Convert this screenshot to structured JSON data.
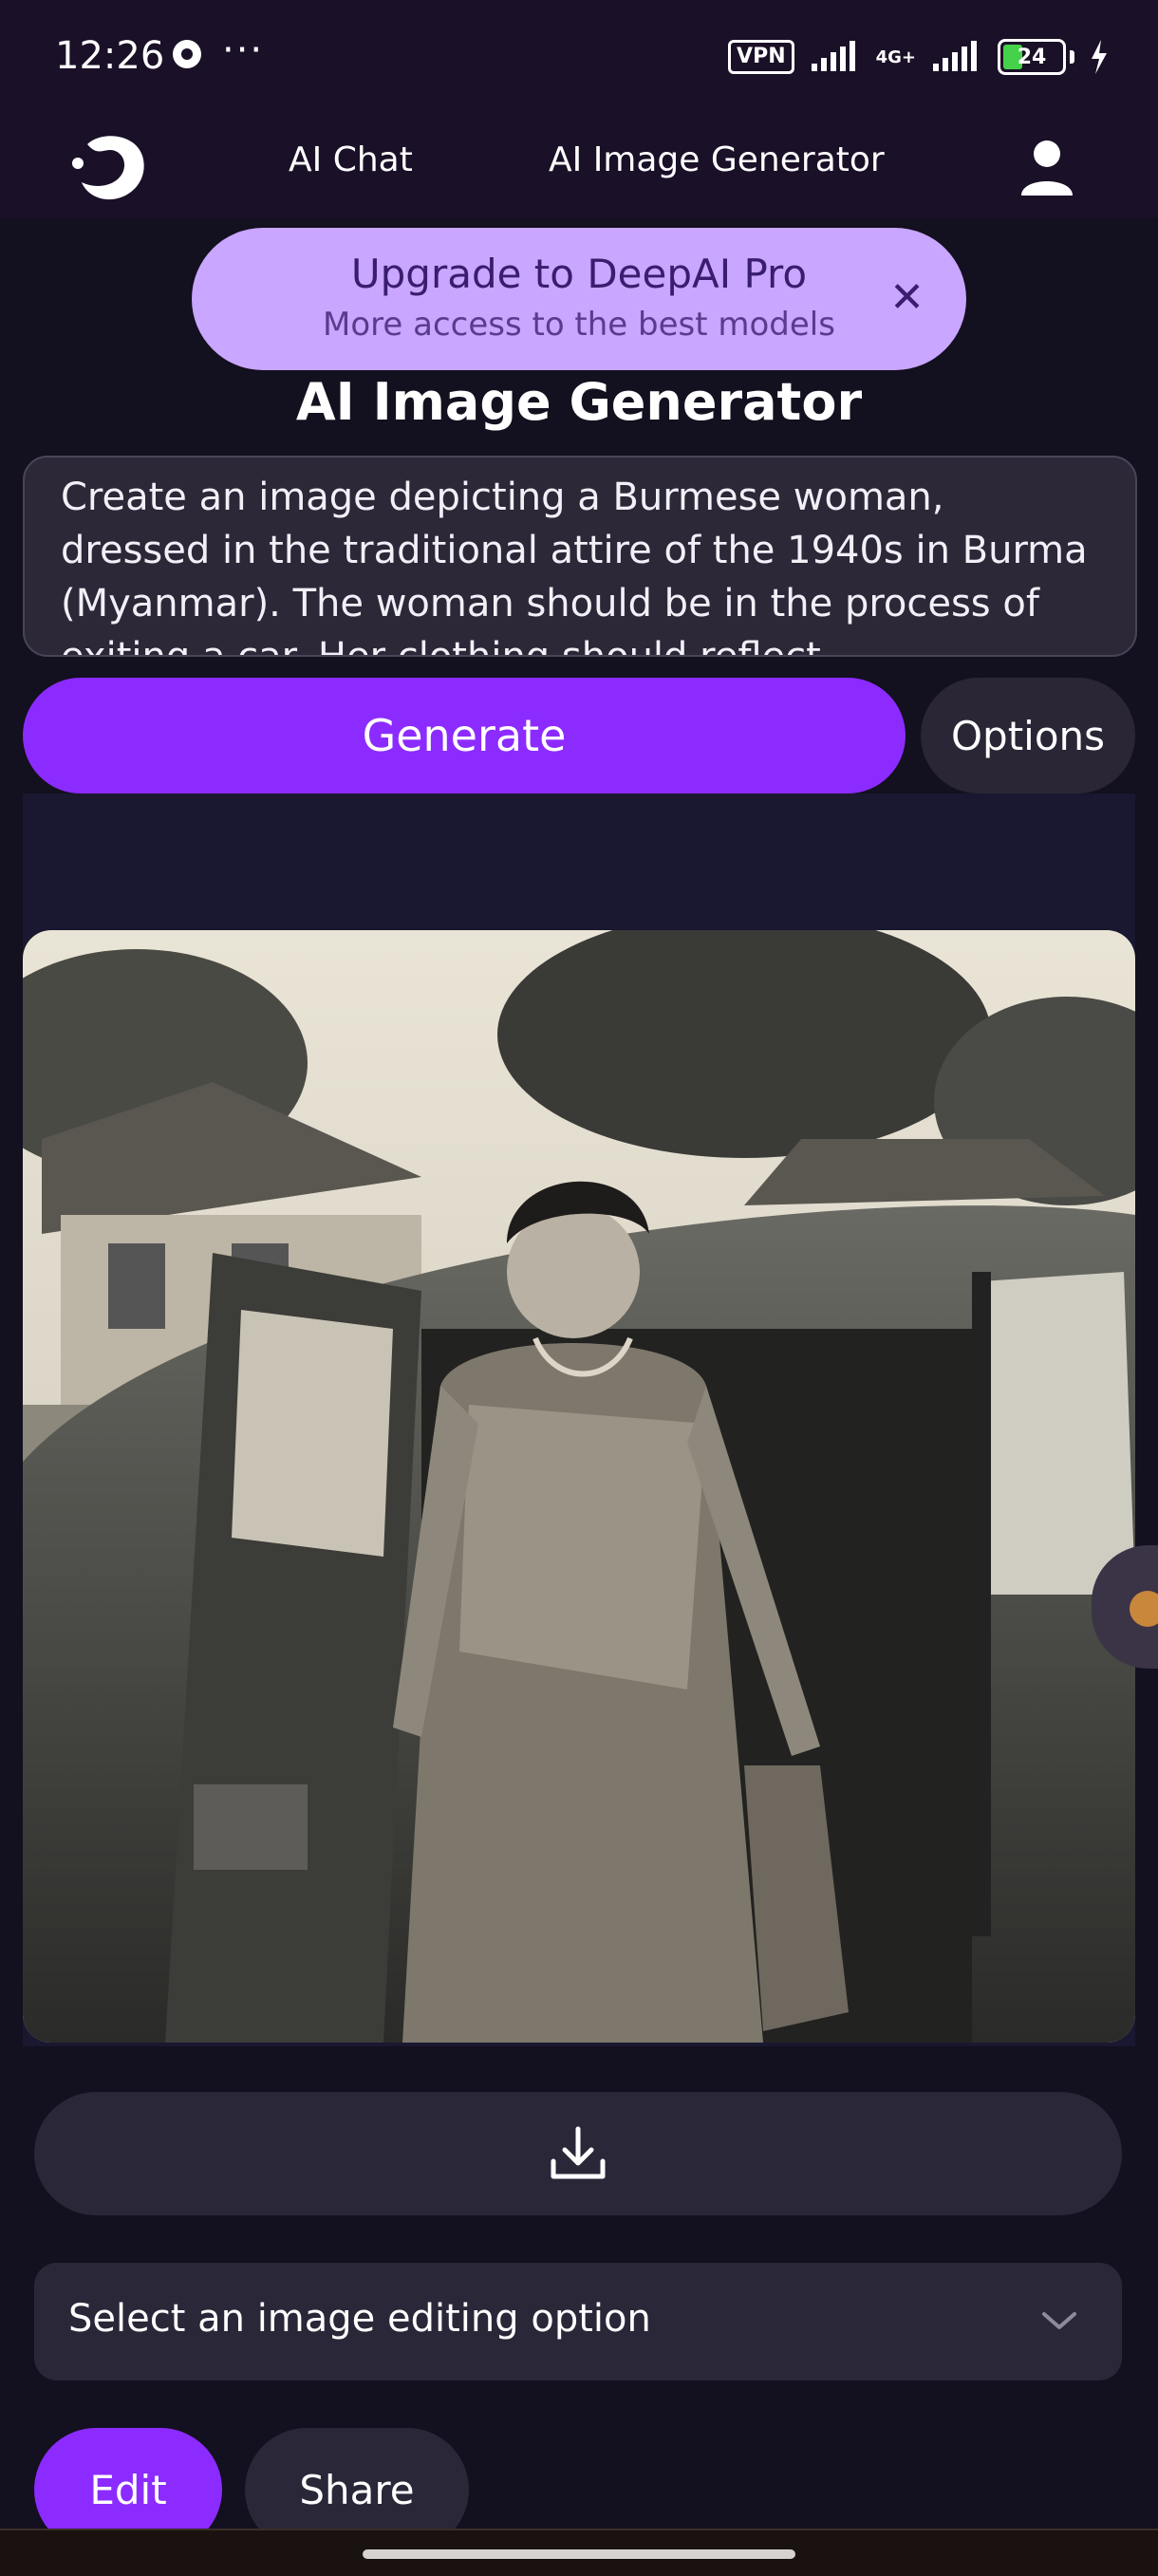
{
  "status_bar": {
    "time": "12:26",
    "more_dots": "···",
    "vpn": "VPN",
    "network": "4G+",
    "battery": "24"
  },
  "header": {
    "nav_chat": "AI Chat",
    "nav_image_generator": "AI Image Generator"
  },
  "promo": {
    "title": "Upgrade to DeepAI Pro",
    "subtitle": "More access to the best models",
    "close": "✕"
  },
  "page": {
    "title": "AI Image Generator"
  },
  "prompt": {
    "text": "Create an image depicting a Burmese woman, dressed in the traditional attire of the 1940s in Burma (Myanmar). The woman should be in the process of exiting a car. Her clothing should reflect"
  },
  "actions": {
    "generate": "Generate",
    "options": "Options"
  },
  "editing": {
    "select_placeholder": "Select an image editing option",
    "edit": "Edit",
    "share": "Share"
  },
  "colors": {
    "accent": "#8c2bff",
    "promo_bg": "#c9a6ff",
    "background": "#13101f"
  }
}
